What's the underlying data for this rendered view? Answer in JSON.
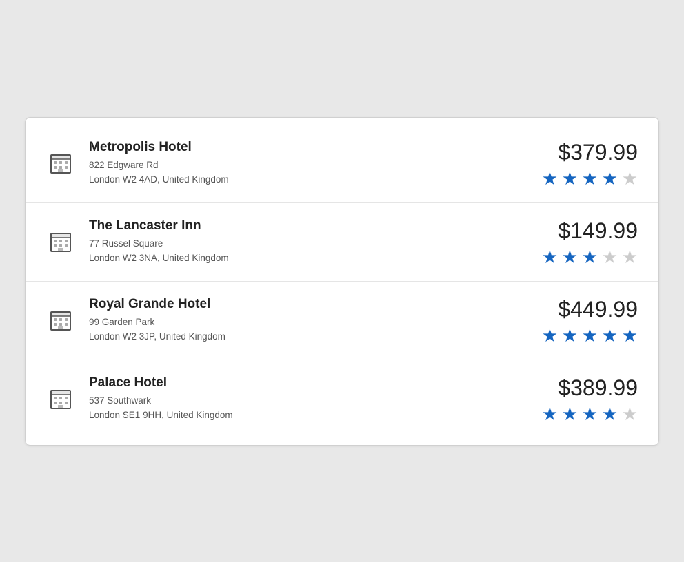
{
  "hotels": [
    {
      "name": "Metropolis Hotel",
      "address_line1": "822 Edgware Rd",
      "address_line2": "London W2 4AD, United Kingdom",
      "price": "$379.99",
      "rating": 4,
      "max_rating": 5
    },
    {
      "name": "The Lancaster Inn",
      "address_line1": "77 Russel Square",
      "address_line2": "London W2 3NA, United Kingdom",
      "price": "$149.99",
      "rating": 3,
      "max_rating": 5
    },
    {
      "name": "Royal Grande Hotel",
      "address_line1": "99 Garden Park",
      "address_line2": "London W2 3JP, United Kingdom",
      "price": "$449.99",
      "rating": 5,
      "max_rating": 5
    },
    {
      "name": "Palace Hotel",
      "address_line1": "537 Southwark",
      "address_line2": "London SE1 9HH, United Kingdom",
      "price": "$389.99",
      "rating": 4,
      "max_rating": 5
    }
  ],
  "icon": {
    "building": "🏨"
  }
}
